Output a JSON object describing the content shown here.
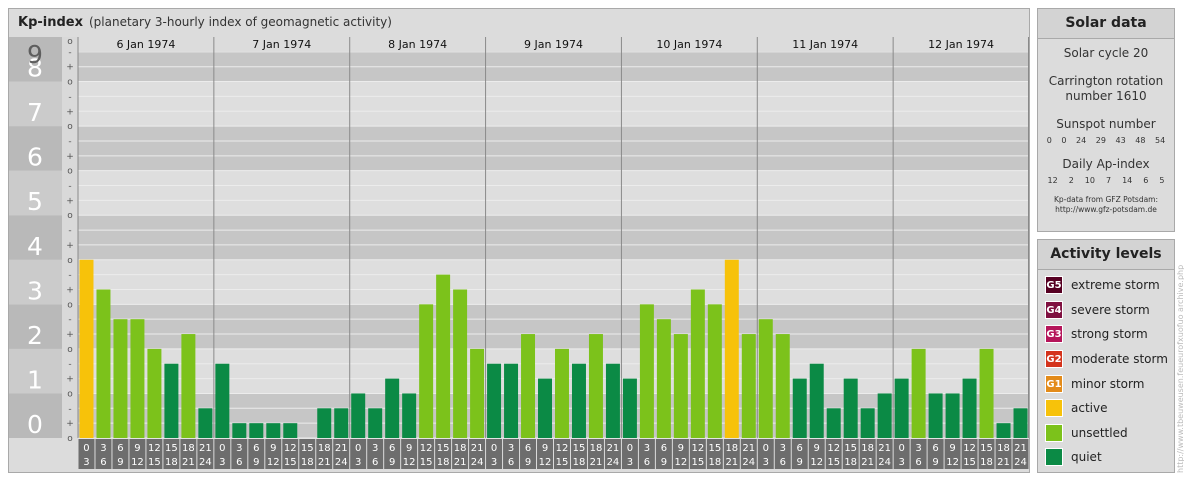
{
  "header": {
    "title": "Kp-index",
    "subtitle": "(planetary 3-hourly index of geomagnetic activity)"
  },
  "chart_data": {
    "type": "bar",
    "y_labels": [
      "0",
      "1",
      "2",
      "3",
      "4",
      "5",
      "6",
      "7",
      "8",
      "9"
    ],
    "minor_labels": [
      "o",
      "+",
      "-"
    ],
    "ylim": [
      0,
      9
    ],
    "days": [
      "6 Jan 1974",
      "7 Jan 1974",
      "8 Jan 1974",
      "9 Jan 1974",
      "10 Jan 1974",
      "11 Jan 1974",
      "12 Jan 1974"
    ],
    "interval_start": [
      "0",
      "3",
      "6",
      "9",
      "12",
      "15",
      "18",
      "21"
    ],
    "interval_end": [
      "3",
      "6",
      "9",
      "12",
      "15",
      "18",
      "21",
      "24"
    ],
    "values": [
      [
        4.0,
        3.333,
        2.667,
        2.667,
        2.0,
        1.667,
        2.333,
        0.667
      ],
      [
        1.667,
        0.333,
        0.333,
        0.333,
        0.333,
        0.0,
        0.667,
        0.667
      ],
      [
        1.0,
        0.667,
        1.333,
        1.0,
        3.0,
        3.667,
        3.333,
        2.0
      ],
      [
        1.667,
        1.667,
        2.333,
        1.333,
        2.0,
        1.667,
        2.333,
        1.667
      ],
      [
        1.333,
        3.0,
        2.667,
        2.333,
        3.333,
        3.0,
        4.0,
        2.333
      ],
      [
        2.667,
        2.333,
        1.333,
        1.667,
        0.667,
        1.333,
        0.667,
        1.0
      ],
      [
        1.333,
        2.0,
        1.0,
        1.0,
        1.333,
        2.0,
        0.333,
        0.667
      ]
    ],
    "colors": {
      "quiet": "#0b8a45",
      "unsettled": "#7cc21b",
      "active": "#f7c20a",
      "minor": "#e38b1a",
      "moderate": "#d4331c",
      "strong": "#b5155a",
      "severe": "#7f1040",
      "extreme": "#560022"
    }
  },
  "solar": {
    "title": "Solar data",
    "cycle": "Solar cycle 20",
    "carrington_1": "Carrington rotation",
    "carrington_2": "number 1610",
    "sunspot_label": "Sunspot number",
    "sunspot": [
      "0",
      "0",
      "24",
      "29",
      "43",
      "48",
      "54"
    ],
    "ap_label": "Daily Ap-index",
    "ap": [
      "12",
      "2",
      "10",
      "7",
      "14",
      "6",
      "5"
    ],
    "note_1": "Kp-data from GFZ Potsdam:",
    "note_2": "http://www.gfz-potsdam.de"
  },
  "levels": {
    "title": "Activity levels",
    "items": [
      {
        "badge": "G5",
        "label": "extreme storm",
        "color": "#560022"
      },
      {
        "badge": "G4",
        "label": "severe storm",
        "color": "#7f1040"
      },
      {
        "badge": "G3",
        "label": "strong storm",
        "color": "#b5155a"
      },
      {
        "badge": "G2",
        "label": "moderate storm",
        "color": "#d4331c"
      },
      {
        "badge": "G1",
        "label": "minor storm",
        "color": "#e38b1a"
      },
      {
        "badge": "",
        "label": "active",
        "color": "#f7c20a"
      },
      {
        "badge": "",
        "label": "unsettled",
        "color": "#7cc21b"
      },
      {
        "badge": "",
        "label": "quiet",
        "color": "#0b8a45"
      }
    ]
  },
  "watermark": "http://www.tbeuweusen.feueurofxuofuo archive.php"
}
